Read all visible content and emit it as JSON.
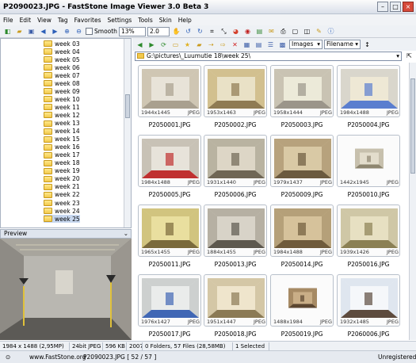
{
  "window": {
    "title": "P2090023.JPG  -  FastStone Image Viewer 3.0 Beta 3"
  },
  "menu": [
    "File",
    "Edit",
    "View",
    "Tag",
    "Favorites",
    "Settings",
    "Tools",
    "Skin",
    "Help"
  ],
  "toolbar": {
    "smooth_label": "Smooth",
    "zoom_value": "13%",
    "scale_value": "2.0"
  },
  "folders": [
    "week 03",
    "week 04",
    "week 05",
    "week 06",
    "week 07",
    "week 08",
    "week 09",
    "week 10",
    "week 11",
    "week 12",
    "week 13",
    "week 14",
    "week 15",
    "week 16",
    "week 17",
    "week 18",
    "week 19",
    "week 20",
    "week 21",
    "week 22",
    "week 23",
    "week 24",
    "week 25"
  ],
  "preview_label": "Preview",
  "browser": {
    "filter_value": "Images",
    "sort_value": "Filename",
    "path": "G:\\pictures\\_Luumutie 18\\week 25\\"
  },
  "thumbnails": [
    {
      "name": "P2050001.JPG",
      "dims": "1944x1445",
      "type": "JPEG"
    },
    {
      "name": "P2050002.JPG",
      "dims": "1953x1463",
      "type": "JPEG"
    },
    {
      "name": "P2050003.JPG",
      "dims": "1958x1444",
      "type": "JPEG"
    },
    {
      "name": "P2050004.JPG",
      "dims": "1984x1488",
      "type": "JPEG"
    },
    {
      "name": "P2050005.JPG",
      "dims": "1984x1488",
      "type": "JPEG"
    },
    {
      "name": "P2050006.JPG",
      "dims": "1931x1440",
      "type": "JPEG"
    },
    {
      "name": "P2050009.JPG",
      "dims": "1979x1437",
      "type": "JPEG"
    },
    {
      "name": "P2050010.JPG",
      "dims": "1442x1945",
      "type": "JPEG"
    },
    {
      "name": "P2050011.JPG",
      "dims": "1965x1455",
      "type": "JPEG"
    },
    {
      "name": "P2050013.JPG",
      "dims": "1884x1455",
      "type": "JPEG"
    },
    {
      "name": "P2050014.JPG",
      "dims": "1984x1488",
      "type": "JPEG"
    },
    {
      "name": "P2050016.JPG",
      "dims": "1939x1426",
      "type": "JPEG"
    },
    {
      "name": "P2050017.JPG",
      "dims": "1976x1427",
      "type": "JPEG"
    },
    {
      "name": "P2050018.JPG",
      "dims": "1951x1447",
      "type": "JPEG"
    },
    {
      "name": "P2050019.JPG",
      "dims": "1488x1984",
      "type": "JPEG"
    },
    {
      "name": "P2060006.JPG",
      "dims": "1932x1485",
      "type": "JPEG"
    }
  ],
  "status": {
    "image_info": "1984 x 1488 (2,95MP)",
    "bit_depth": "24bit JPEG",
    "file_size": "596 KB",
    "year": "2007",
    "folder_stats": "0 Folders, 57 Files (28,58MB)",
    "selected": "1 Selected",
    "website": "www.FastStone.org",
    "current_file": "P2090023.JPG [ 52 / 57 ]",
    "registration": "Unregistered"
  }
}
